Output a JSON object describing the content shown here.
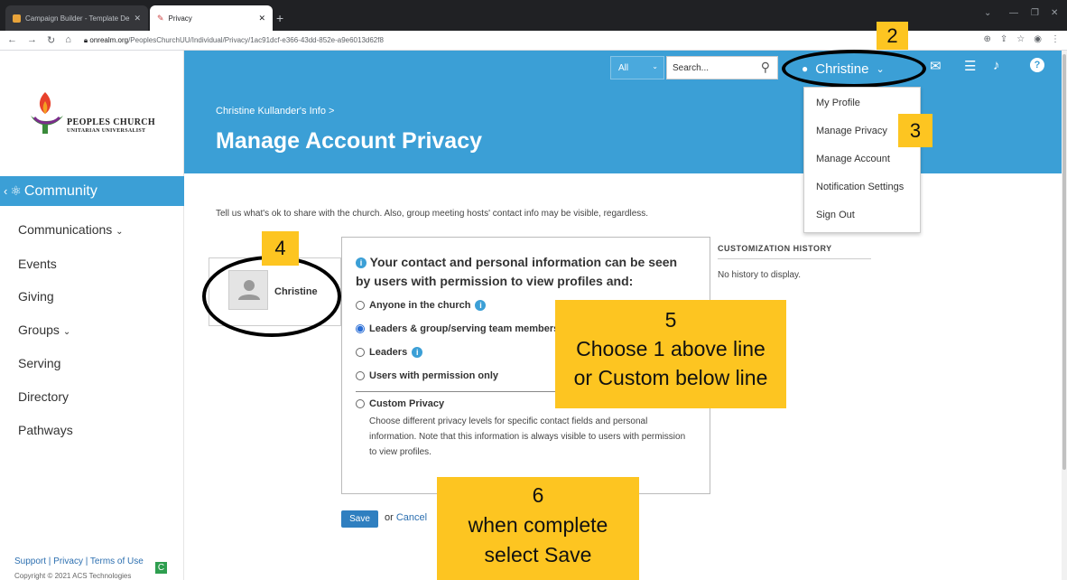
{
  "browser": {
    "tabs": [
      {
        "label": "Campaign Builder - Template De",
        "active": false
      },
      {
        "label": "Privacy",
        "active": true
      }
    ],
    "url_host": "onrealm.org",
    "url_path": "/PeoplesChurchUU/Individual/Privacy/1ac91dcf-e366-43dd-852e-a9e6013d62f8",
    "new_tab": "+"
  },
  "logo": {
    "line1": "PEOPLES CHURCH",
    "line2": "UNITARIAN UNIVERSALIST"
  },
  "sidebar": {
    "section": "Community",
    "items": [
      {
        "label": "Communications",
        "has_chevron": true
      },
      {
        "label": "Events",
        "has_chevron": false
      },
      {
        "label": "Giving",
        "has_chevron": false
      },
      {
        "label": "Groups",
        "has_chevron": true
      },
      {
        "label": "Serving",
        "has_chevron": false
      },
      {
        "label": "Directory",
        "has_chevron": false
      },
      {
        "label": "Pathways",
        "has_chevron": false
      }
    ],
    "footer_links": "Support | Privacy | Terms of Use",
    "copyright": "Copyright © 2021 ACS Technologies",
    "badge": "C"
  },
  "header": {
    "breadcrumb": "Christine Kullander's Info >",
    "title": "Manage Account Privacy",
    "scope_select": "All",
    "search_placeholder": "Search...",
    "user_name": "Christine"
  },
  "user_dropdown": [
    "My Profile",
    "Manage Privacy",
    "Manage Account",
    "Notification Settings",
    "Sign Out"
  ],
  "main": {
    "intro": "Tell us what's ok to share with the church. Also, group meeting hosts' contact info may be visible, regardless.",
    "profile_name": "Christine",
    "privacy_heading": "Your contact and personal information can be seen by users with permission to view profiles and:",
    "options": [
      {
        "label": "Anyone in the church",
        "info": true,
        "selected": false
      },
      {
        "label": "Leaders & group/serving team members",
        "info": false,
        "selected": true
      },
      {
        "label": "Leaders",
        "info": true,
        "selected": false
      },
      {
        "label": "Users with permission only",
        "info": false,
        "selected": false
      }
    ],
    "custom_label": "Custom Privacy",
    "custom_desc": "Choose different privacy levels for specific contact fields and personal information. Note that this information is always visible to users with permission to view profiles.",
    "save_label": "Save",
    "or_text": "or",
    "cancel_label": "Cancel"
  },
  "history": {
    "title": "CUSTOMIZATION HISTORY",
    "empty": "No history to display."
  },
  "annotations": {
    "n2": "2",
    "n3": "3",
    "n4": "4",
    "n5_num": "5",
    "n5_line1": "Choose 1 above line",
    "n5_line2": "or Custom below line",
    "n6_num": "6",
    "n6_line1": "when complete",
    "n6_line2": "select Save"
  },
  "colors": {
    "brand_blue": "#3b9fd6",
    "note_yellow": "#fdc521",
    "save_blue": "#2f7fc0"
  }
}
